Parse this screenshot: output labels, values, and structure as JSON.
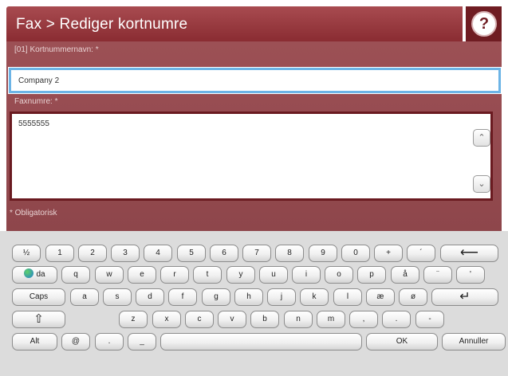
{
  "header": {
    "title": "Fax > Rediger kortnumre",
    "help_icon": "help-icon",
    "help_glyph": "?"
  },
  "form": {
    "name_label": "[01] Kortnummernavn: *",
    "name_value": "Company 2",
    "fax_label": "Faxnumre: *",
    "fax_value": "5555555",
    "required_note": "* Obligatorisk",
    "scroll_up_glyph": "⌃",
    "scroll_down_glyph": "⌄"
  },
  "keyboard": {
    "row1": [
      "½",
      "1",
      "2",
      "3",
      "4",
      "5",
      "6",
      "7",
      "8",
      "9",
      "0",
      "+",
      "´"
    ],
    "backspace_glyph": "⟵",
    "row2_lang": "da",
    "row2": [
      "q",
      "w",
      "e",
      "r",
      "t",
      "y",
      "u",
      "i",
      "o",
      "p",
      "å",
      "¨",
      "'"
    ],
    "caps_label": "Caps",
    "row3": [
      "a",
      "s",
      "d",
      "f",
      "g",
      "h",
      "j",
      "k",
      "l",
      "æ",
      "ø"
    ],
    "enter_glyph": "↵",
    "shift_glyph": "⇧",
    "row4": [
      "z",
      "x",
      "c",
      "v",
      "b",
      "n",
      "m",
      ",",
      ".",
      "-"
    ],
    "alt_label": "Alt",
    "at_label": "@",
    "dot_label": ".",
    "underscore_label": "_",
    "ok_label": "OK",
    "cancel_label": "Annuller",
    "erase_icon": "eraser-icon"
  }
}
